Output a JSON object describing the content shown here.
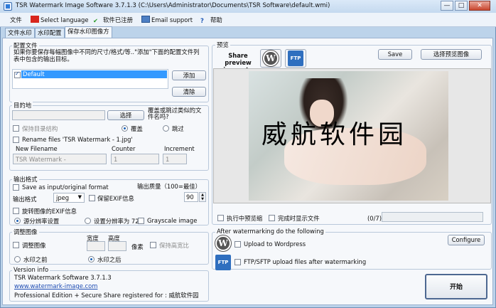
{
  "window": {
    "title": "TSR Watermark Image Software 3.7.1.3 (C:\\Users\\Administrator\\Documents\\TSR Software\\default.wmi)",
    "controls": [
      "—",
      "□",
      "✕"
    ]
  },
  "menu": [
    "文件",
    "Select language",
    "软件已注册",
    "Email support",
    "帮助"
  ],
  "tabs": [
    "文件水印",
    "水印配置",
    "保存水印图像方"
  ],
  "config": {
    "title": "配置文件",
    "description": "如果你要保存每幅图像中不同的尺寸/格式/等..\"添加\"下面的配置文件列表中包含的输出目标。",
    "items": [
      "Default"
    ],
    "add_label": "添加",
    "remove_label": "清除"
  },
  "destination": {
    "title": "目的地",
    "path": "",
    "choose_label": "选择",
    "overwrite_question": "覆盖或跳过类似的文件名吗?",
    "keep_structure": "保持目录结构",
    "overwrite": "覆盖",
    "skip": "跳过",
    "rename_label": "Rename files 'TSR Watermark - 1.jpg'",
    "new_filename_label": "New Filename",
    "new_filename_value": "TSR Watermark -",
    "counter_label": "Counter",
    "counter_value": "1",
    "increment_label": "Increment",
    "increment_value": "1"
  },
  "output": {
    "title": "输出格式",
    "save_as_input": "Save as input/original format",
    "quality_label": "输出质量（100=最佳）",
    "format_label": "输出格式",
    "format_value": "jpeg",
    "keep_exif": "保留EXIF信息",
    "quality_value": "90",
    "rotate_exif": "旋转图像的EXIF信息",
    "source_dpi": "源分辨率设置",
    "set_dpi": "设置分辨率为 72",
    "grayscale": "Grayscale image"
  },
  "resize": {
    "title": "调整图像",
    "width_label": "宽度",
    "height_label": "高度",
    "resize_label": "调整图像",
    "pixels_label": "像素",
    "keep_ratio": "保持高宽比",
    "before": "水印之前",
    "after": "水印之后"
  },
  "version": {
    "title": "Version info",
    "line1": "TSR Watermark Software 3.7.1.3",
    "link": "www.watermark-image.com",
    "line3": "Professional Edition + Secure Share registered for : 威航软件园"
  },
  "preview": {
    "title": "预览",
    "share_label": "Share preview image to",
    "save_label": "Save",
    "choose_preview_label": "选择预览图像",
    "wp_text": "W",
    "ftp_text": "FTP",
    "watermark_text": "威航软件园"
  },
  "run": {
    "preview_while_running": "执行中预览缩",
    "show_files_done": "完成时显示文件",
    "progress_text": "(0/7)",
    "progress": 0
  },
  "after": {
    "title": "After watermarking do the following",
    "configure_label": "Configure",
    "upload_wp": "Upload to Wordpress",
    "upload_ftp": "FTP/SFTP upload files after watermarking",
    "start_label": "开始"
  }
}
